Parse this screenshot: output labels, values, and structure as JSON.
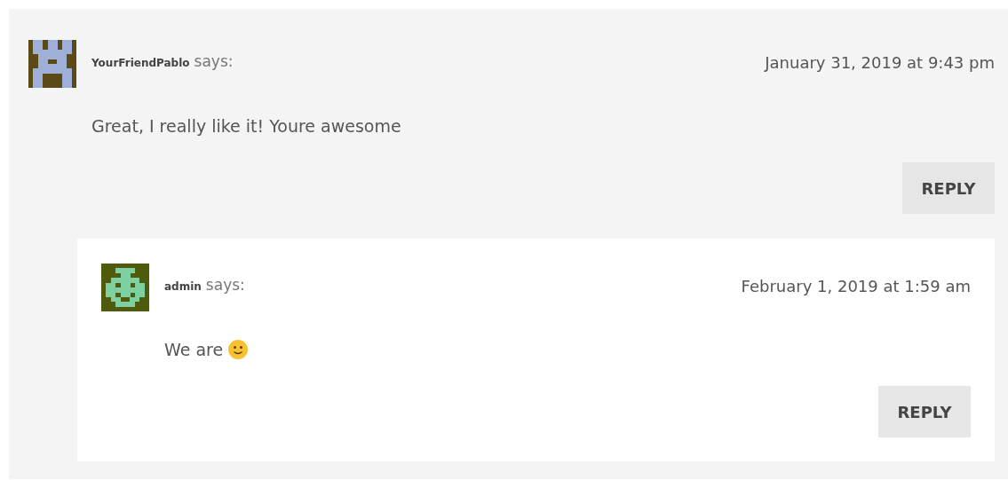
{
  "comments": [
    {
      "author": "YourFriendPablo",
      "says": "says:",
      "date": "January 31, 2019 at 9:43 pm",
      "text": "Great, I really like it! Youre awesome",
      "reply": "REPLY",
      "children": [
        {
          "author": "admin",
          "says": "says:",
          "date": "February 1, 2019 at 1:59 am",
          "text": "We are",
          "emoji": true,
          "reply": "REPLY"
        }
      ]
    }
  ]
}
